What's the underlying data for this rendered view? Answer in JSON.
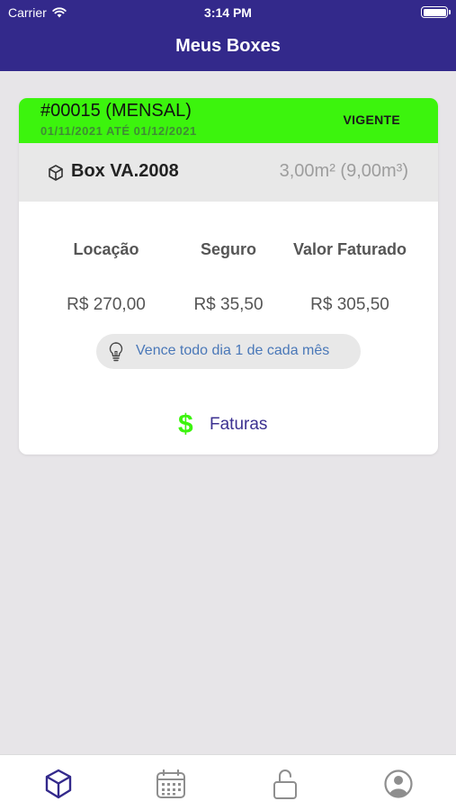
{
  "status_bar": {
    "carrier": "Carrier",
    "time": "3:14 PM"
  },
  "nav": {
    "title": "Meus Boxes"
  },
  "contract": {
    "id": "#00015 (MENSAL)",
    "period": "01/11/2021 ATÉ 01/12/2021",
    "status": "VIGENTE",
    "accent_color": "#3cf40d"
  },
  "box": {
    "icon": "cube-icon",
    "name": "Box VA.2008",
    "size": "3,00m² (9,00m³)"
  },
  "summary": {
    "columns": [
      {
        "label": "Locação",
        "value": "R$ 270,00"
      },
      {
        "label": "Seguro",
        "value": "R$ 35,50"
      },
      {
        "label": "Valor Faturado",
        "value": "R$ 305,50"
      }
    ]
  },
  "due_info": {
    "icon": "lightbulb-icon",
    "text": "Vence todo dia 1 de cada mês"
  },
  "invoices": {
    "icon": "dollar-icon",
    "symbol": "$",
    "label": "Faturas"
  },
  "tabbar": {
    "tabs": [
      {
        "name": "boxes",
        "icon": "cube-icon",
        "active": true
      },
      {
        "name": "calendar",
        "icon": "calendar-icon",
        "active": false
      },
      {
        "name": "access",
        "icon": "unlock-icon",
        "active": false
      },
      {
        "name": "profile",
        "icon": "user-circle-icon",
        "active": false
      }
    ],
    "active_color": "#33298b",
    "inactive_color": "#8e8e8e"
  },
  "colors": {
    "header": "#33298b",
    "background": "#e7e5e8"
  }
}
